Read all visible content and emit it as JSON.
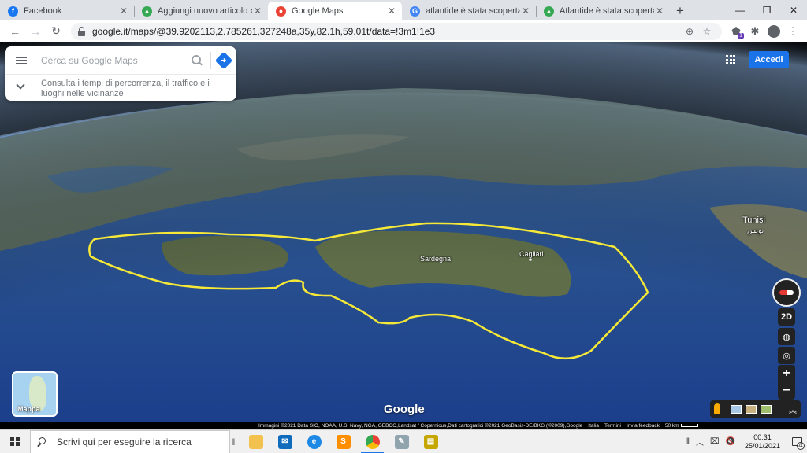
{
  "browser": {
    "tabs": [
      {
        "title": "Facebook",
        "icon": "facebook-icon",
        "color": "#1877f2",
        "glyph": "f",
        "active": false
      },
      {
        "title": "Aggiungi nuovo articolo ‹ Atlantide",
        "icon": "page-icon",
        "color": "#34a853",
        "glyph": "▲",
        "active": false
      },
      {
        "title": "Google Maps",
        "icon": "maps-pin-icon",
        "color": "#ea4335",
        "glyph": "●",
        "active": true
      },
      {
        "title": "atlantide è stata scoperta da un",
        "icon": "google-icon",
        "color": "#4285f4",
        "glyph": "G",
        "active": false
      },
      {
        "title": "Atlantide è stata scoperta nel G",
        "icon": "page-icon",
        "color": "#34a853",
        "glyph": "▲",
        "active": false
      }
    ],
    "new_tab": "+",
    "url": "google.it/maps/@39.9202113,2.785261,327248a,35y,82.1h,59.01t/data=!3m1!1e3",
    "extension_badge": "1"
  },
  "maps": {
    "search_placeholder": "Cerca su Google Maps",
    "suggestion": "Consulta i tempi di percorrenza, il traffico e i luoghi nelle vicinanze",
    "signin_label": "Accedi",
    "brand_color": "#1a73e8",
    "labels": {
      "tunisi": "Tunisi",
      "tunisi_arabic": "تونس",
      "sardegna": "Sardegna",
      "cagliari": "Cagliari"
    },
    "controls": {
      "view_2d": "2D",
      "zoom_in": "+",
      "zoom_out": "−"
    },
    "layer_label": "Mappa",
    "logo": "Google",
    "attribution": {
      "imagery": "Immagini ©2021 Data SIO, NOAA, U.S. Navy, NGA, GEBCO,Landsat / Copernicus,Dati cartografici ©2021 GeoBasis-DE/BKG (©2009),Google",
      "country": "Italia",
      "terms": "Termini",
      "feedback": "Invia feedback",
      "scale": "50 km"
    },
    "outline_color": "#f5e837"
  },
  "taskbar": {
    "search_placeholder": "Scrivi qui per eseguire la ricerca",
    "time": "00:31",
    "date": "25/01/2021",
    "notifications": "4"
  }
}
